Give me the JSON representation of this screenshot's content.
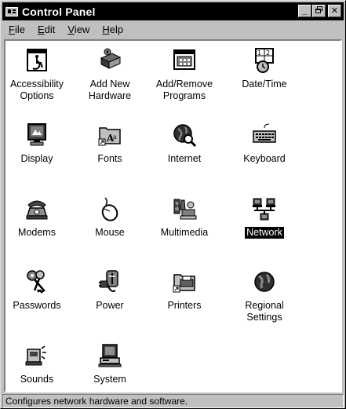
{
  "window": {
    "title": "Control Panel",
    "buttons": {
      "minimize": "_",
      "maximize": "▫",
      "close": "✕"
    }
  },
  "menubar": {
    "items": [
      {
        "label_first": "F",
        "label_rest": "ile"
      },
      {
        "label_first": "E",
        "label_rest": "dit"
      },
      {
        "label_first": "V",
        "label_rest": "iew"
      },
      {
        "label_first": "H",
        "label_rest": "elp"
      }
    ]
  },
  "icons": [
    {
      "label": "Accessibility Options",
      "icon": "accessibility-icon"
    },
    {
      "label": "Add New Hardware",
      "icon": "add-hardware-icon"
    },
    {
      "label": "Add/Remove Programs",
      "icon": "add-remove-programs-icon"
    },
    {
      "label": "Date/Time",
      "icon": "calendar-clock-icon"
    },
    {
      "label": "Display",
      "icon": "display-monitor-icon"
    },
    {
      "label": "Fonts",
      "icon": "fonts-folder-icon"
    },
    {
      "label": "Internet",
      "icon": "internet-globe-icon"
    },
    {
      "label": "Keyboard",
      "icon": "keyboard-icon"
    },
    {
      "label": "Modems",
      "icon": "modem-phone-icon"
    },
    {
      "label": "Mouse",
      "icon": "mouse-icon"
    },
    {
      "label": "Multimedia",
      "icon": "multimedia-icon"
    },
    {
      "label": "Network",
      "icon": "network-icon",
      "selected": true
    },
    {
      "label": "Passwords",
      "icon": "keys-icon"
    },
    {
      "label": "Power",
      "icon": "power-plug-icon"
    },
    {
      "label": "Printers",
      "icon": "printer-folder-icon"
    },
    {
      "label": "Regional Settings",
      "icon": "globe-icon"
    },
    {
      "label": "Sounds",
      "icon": "speaker-icon"
    },
    {
      "label": "System",
      "icon": "computer-icon"
    }
  ],
  "statusbar": {
    "text": "Configures network hardware and software."
  }
}
